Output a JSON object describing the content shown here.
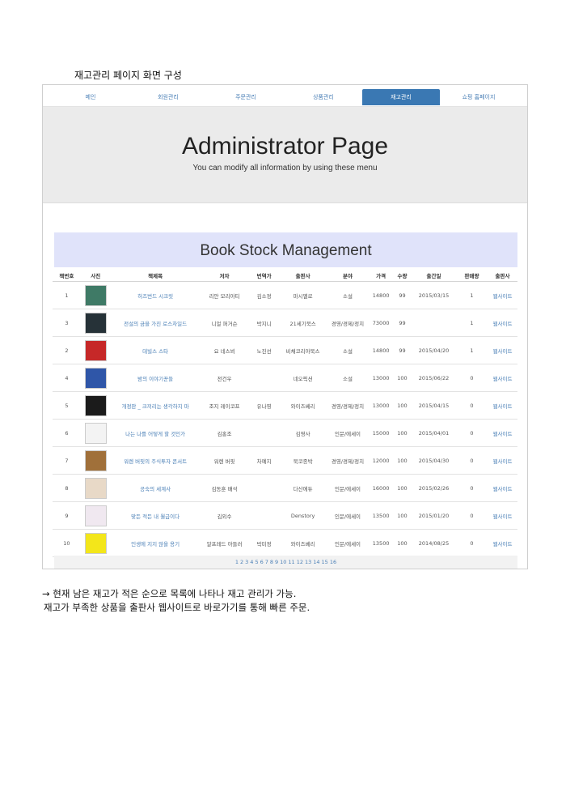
{
  "doc_caption": "재고관리 페이지 화면 구성",
  "nav": {
    "items": [
      "메인",
      "회원관리",
      "주문관리",
      "상품관리",
      "재고관리",
      "쇼핑 홈페이지"
    ],
    "active_index": 4
  },
  "hero": {
    "title": "Administrator Page",
    "subtitle": "You can modify all information by using these menu"
  },
  "panel_title": "Book Stock Management",
  "table": {
    "headers": [
      "책번호",
      "사진",
      "책제목",
      "저자",
      "번역가",
      "출판사",
      "분야",
      "가격",
      "수량",
      "출간일",
      "판매량",
      "출판사"
    ],
    "rows": [
      {
        "no": "1",
        "title": "허즈번드 시크릿",
        "author": "리안 모리아티",
        "translator": "김소정",
        "publisher": "마시멜로",
        "genre": "소설",
        "price": "14800",
        "qty": "99",
        "date": "2015/03/15",
        "sold": "1",
        "site": "웹사이트",
        "cover": "#3f7a66"
      },
      {
        "no": "3",
        "title": "전설의 금을 가진 로스차일드",
        "author": "니얼 퍼거슨",
        "translator": "박지니",
        "publisher": "21세기북스",
        "genre": "경영/경제/정치",
        "price": "73000",
        "qty": "99",
        "date": "",
        "sold": "1",
        "site": "웹사이트",
        "cover": "#263238"
      },
      {
        "no": "2",
        "title": "데빌스 스타",
        "author": "요 네스뵈",
        "translator": "노진선",
        "publisher": "비채코리아북스",
        "genre": "소설",
        "price": "14800",
        "qty": "99",
        "date": "2015/04/20",
        "sold": "1",
        "site": "웹사이트",
        "cover": "#c62828"
      },
      {
        "no": "4",
        "title": "밤의 이야기꾼들",
        "author": "전건우",
        "translator": "",
        "publisher": "네오픽션",
        "genre": "소설",
        "price": "13000",
        "qty": "100",
        "date": "2015/06/22",
        "sold": "0",
        "site": "웹사이트",
        "cover": "#2f56a8"
      },
      {
        "no": "5",
        "title": "개정판 _ 크끼리는 생각하지 마",
        "author": "조지 레이코프",
        "translator": "유나영",
        "publisher": "와이즈베리",
        "genre": "경영/경제/정치",
        "price": "13000",
        "qty": "100",
        "date": "2015/04/15",
        "sold": "0",
        "site": "웹사이트",
        "cover": "#1b1b1b"
      },
      {
        "no": "6",
        "title": "나는 나를 어떻게 할 것인가",
        "author": "김홍조",
        "translator": "",
        "publisher": "김영사",
        "genre": "인문/에세이",
        "price": "15000",
        "qty": "100",
        "date": "2015/04/01",
        "sold": "0",
        "site": "웹사이트",
        "cover": "#f3f3f3"
      },
      {
        "no": "7",
        "title": "워렌 버핏의 주식투자 콘서트",
        "author": "워렌 버핏",
        "translator": "차예지",
        "publisher": "북코종박",
        "genre": "경영/경제/정치",
        "price": "12000",
        "qty": "100",
        "date": "2015/04/30",
        "sold": "0",
        "site": "웹사이트",
        "cover": "#a0703a"
      },
      {
        "no": "8",
        "title": "공숙의 세계사",
        "author": "김동훈 배석",
        "translator": "",
        "publisher": "다산에듀",
        "genre": "인문/에세이",
        "price": "16000",
        "qty": "100",
        "date": "2015/02/26",
        "sold": "0",
        "site": "웹사이트",
        "cover": "#e8d9c7"
      },
      {
        "no": "9",
        "title": "맞든 적든 내 월급이다",
        "author": "김외수",
        "translator": "",
        "publisher": "Denstory",
        "genre": "인문/에세이",
        "price": "13500",
        "qty": "100",
        "date": "2015/01/20",
        "sold": "0",
        "site": "웹사이트",
        "cover": "#f0e8f0"
      },
      {
        "no": "10",
        "title": "인생에 지지 않을 용기",
        "author": "알프레드 아들러",
        "translator": "박미정",
        "publisher": "와이즈베리",
        "genre": "인문/에세이",
        "price": "13500",
        "qty": "100",
        "date": "2014/08/25",
        "sold": "0",
        "site": "웹사이트",
        "cover": "#f3e61a"
      }
    ]
  },
  "pager": [
    "1",
    "2",
    "3",
    "4",
    "5",
    "6",
    "7",
    "8",
    "9",
    "10",
    "11",
    "12",
    "13",
    "14",
    "15",
    "16"
  ],
  "notes": [
    "→ 현재 남은 재고가 적은 순으로 목록에 나타나 재고 관리가 가능.",
    "재고가 부족한 상품을 출판사 웹사이트로 바로가기를 통해 빠른 주문."
  ]
}
